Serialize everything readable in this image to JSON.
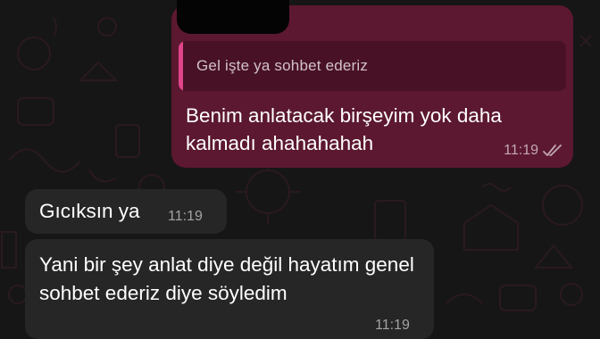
{
  "colors": {
    "background": "#161616",
    "outgoing_bubble": "#5c1830",
    "quote_background": "#481126",
    "quote_accent": "#e0458a",
    "incoming_bubble": "#262626"
  },
  "outgoing": {
    "quote_text": "Gel işte ya sohbet ederiz",
    "text": "Benim anlatacak birşeyim yok daha kalmadı ahahahahah",
    "time": "11:19",
    "status_icon": "double-check-icon"
  },
  "incoming": [
    {
      "text": "Gıcıksın ya",
      "time": "11:19"
    },
    {
      "text": "Yani bir şey anlat diye değil hayatım genel sohbet ederiz diye söyledim",
      "time": "11:19"
    }
  ]
}
